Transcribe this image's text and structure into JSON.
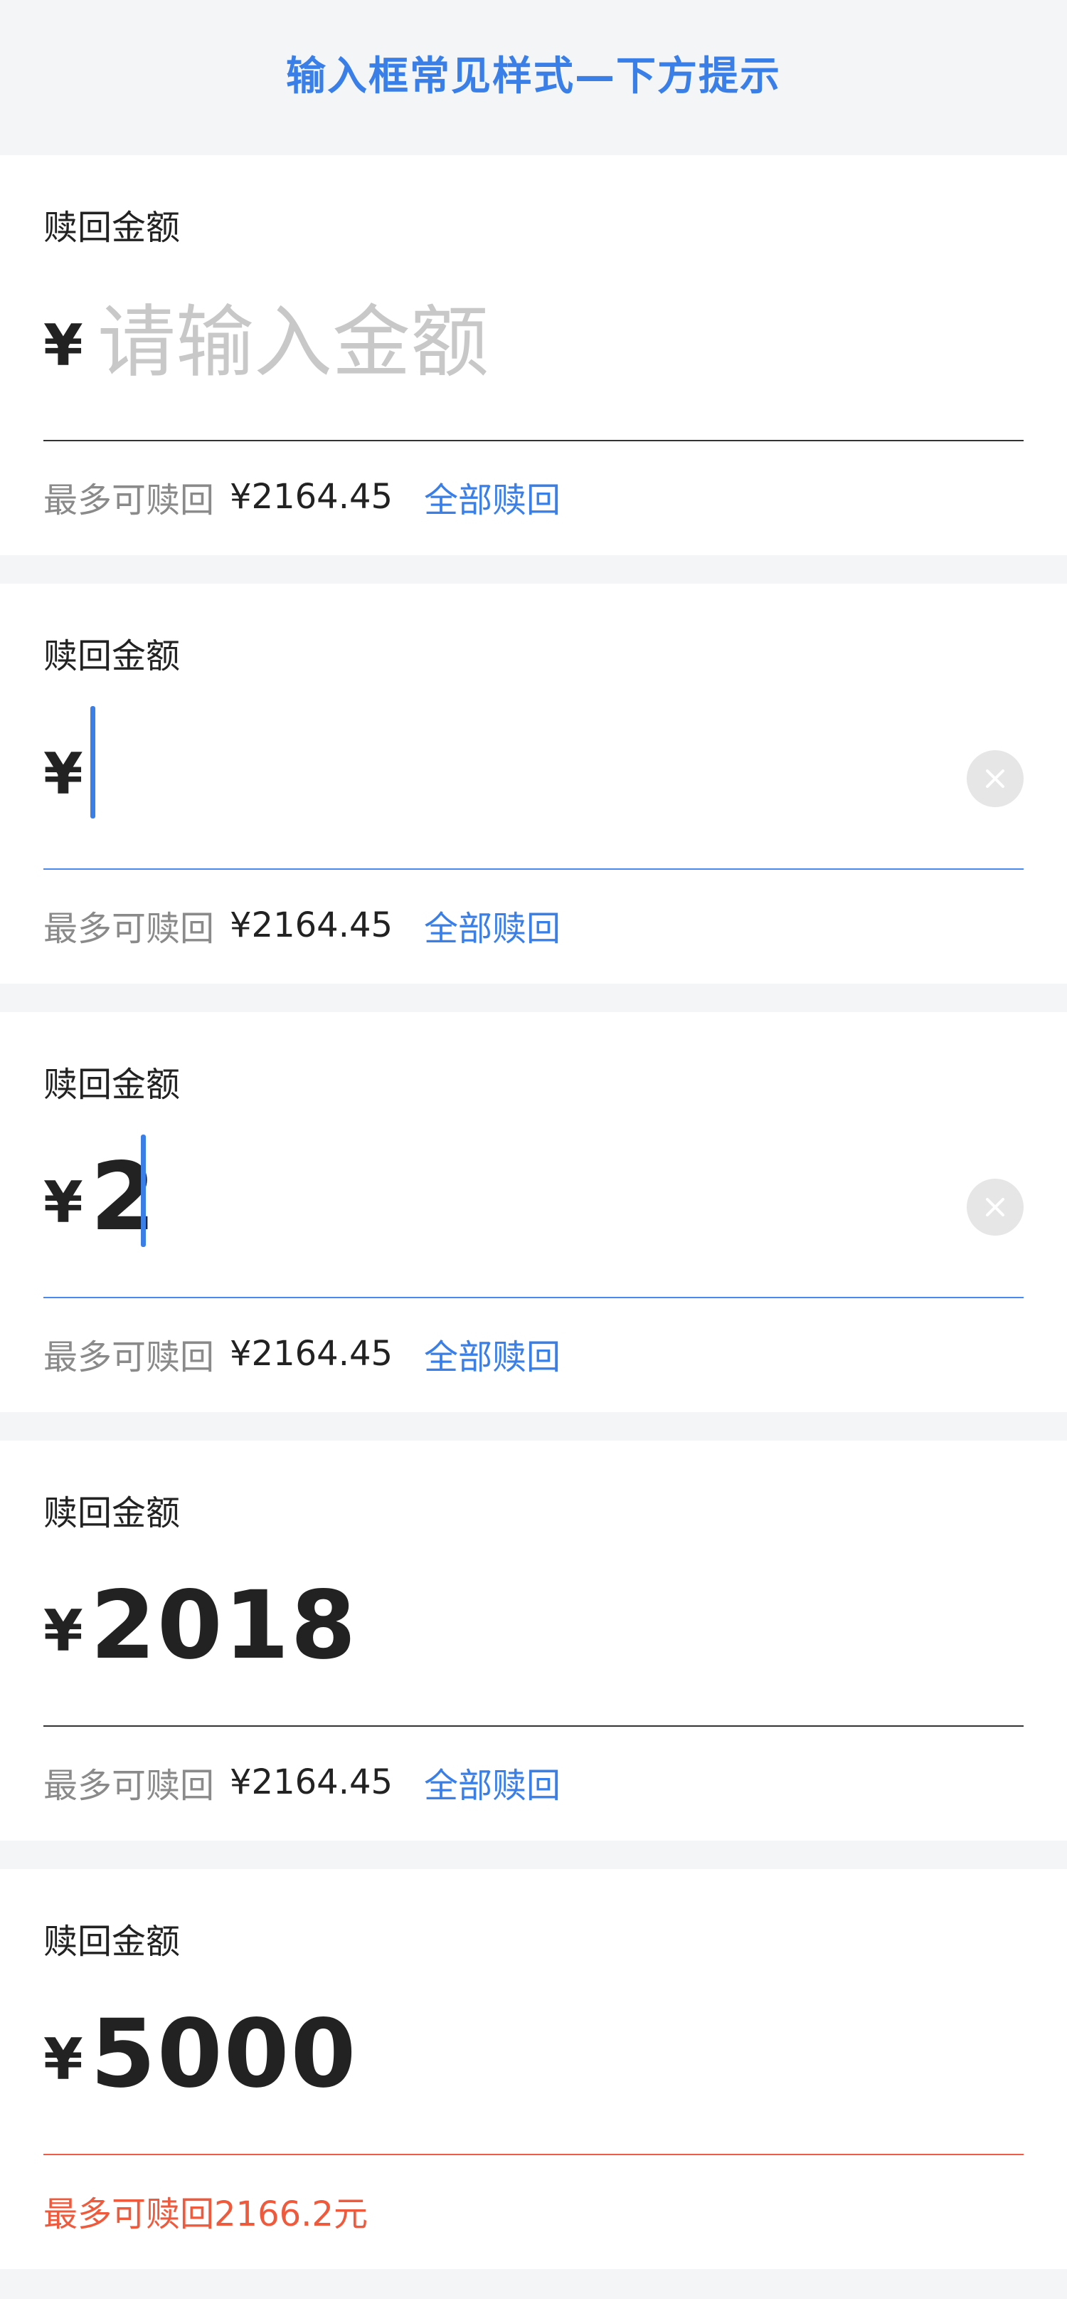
{
  "header": {
    "title": "输入框常见样式—下方提示"
  },
  "colors": {
    "accent": "#3a7fe8",
    "error": "#f05a3c",
    "placeholder": "#c8c8c8"
  },
  "icons": {
    "clear": "clear-circle-icon"
  },
  "cards": [
    {
      "label": "赎回金额",
      "currency": "¥",
      "placeholder": "请输入金额",
      "value": "",
      "state": "empty",
      "hint_prefix": "最多可赎回",
      "hint_amount": "¥2164.45",
      "hint_link": "全部赎回"
    },
    {
      "label": "赎回金额",
      "currency": "¥",
      "value": "",
      "state": "focused",
      "hint_prefix": "最多可赎回",
      "hint_amount": "¥2164.45",
      "hint_link": "全部赎回"
    },
    {
      "label": "赎回金额",
      "currency": "¥",
      "value": "2",
      "state": "typing",
      "hint_prefix": "最多可赎回",
      "hint_amount": "¥2164.45",
      "hint_link": "全部赎回"
    },
    {
      "label": "赎回金额",
      "currency": "¥",
      "value": "2018",
      "state": "filled",
      "hint_prefix": "最多可赎回",
      "hint_amount": "¥2164.45",
      "hint_link": "全部赎回"
    },
    {
      "label": "赎回金额",
      "currency": "¥",
      "value": "5000",
      "state": "error",
      "error_text": "最多可赎回2166.2元"
    }
  ]
}
